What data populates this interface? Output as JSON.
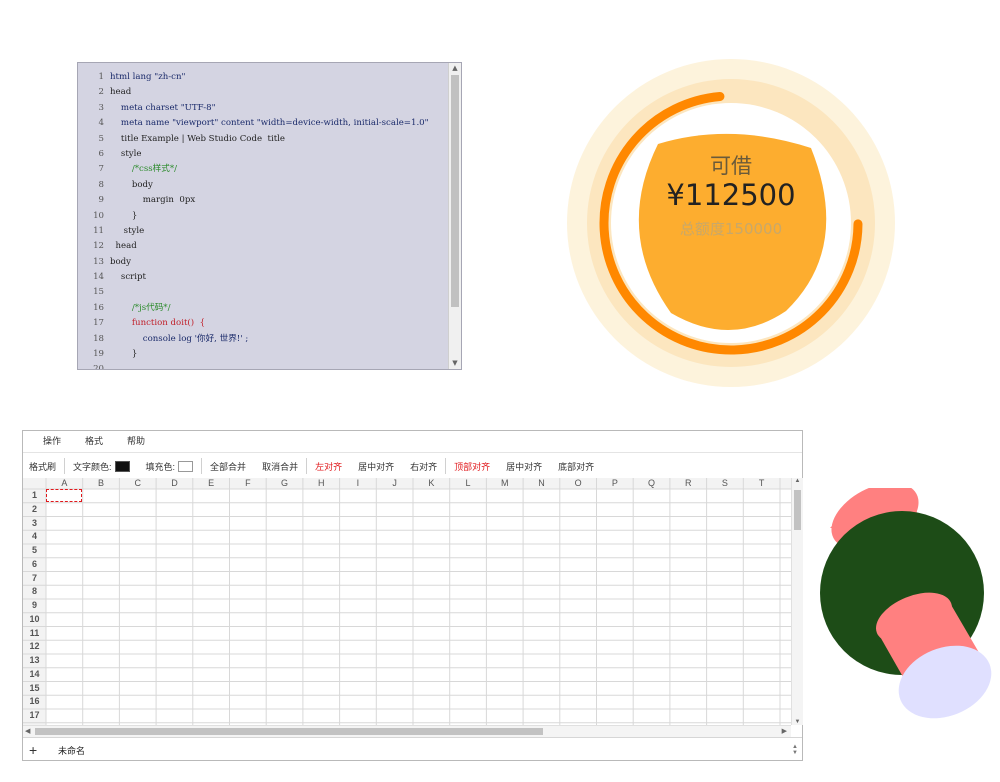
{
  "editor": {
    "lines": [
      {
        "n": "1",
        "text": "html lang \"zh-cn\""
      },
      {
        "n": "2",
        "text": "head"
      },
      {
        "n": "3",
        "text": "    meta charset \"UTF-8\""
      },
      {
        "n": "4",
        "text": "    meta name \"viewport\" content \"width=device-width, initial-scale=1.0\""
      },
      {
        "n": "5",
        "text": "    title Example | Web Studio Code  title"
      },
      {
        "n": "6",
        "text": "    style"
      },
      {
        "n": "7",
        "text": "        /*css样式*/"
      },
      {
        "n": "8",
        "text": "        body"
      },
      {
        "n": "9",
        "text": "            margin  0px"
      },
      {
        "n": "10",
        "text": "        }"
      },
      {
        "n": "11",
        "text": "     style"
      },
      {
        "n": "12",
        "text": "  head"
      },
      {
        "n": "13",
        "text": "body"
      },
      {
        "n": "14",
        "text": "    script"
      },
      {
        "n": "15",
        "text": ""
      },
      {
        "n": "16",
        "text": "        /*js代码*/"
      },
      {
        "n": "17",
        "text": "        function doit()  {"
      },
      {
        "n": "18",
        "text": "            console log '你好, 世界!' ;"
      },
      {
        "n": "19",
        "text": "        }"
      },
      {
        "n": "20",
        "text": ""
      }
    ],
    "scroll_up": "▲",
    "scroll_down": "▼"
  },
  "gauge": {
    "title": "可借",
    "amount": "¥112500",
    "total": "总额度150000",
    "available": 112500,
    "limit": 150000,
    "colors": {
      "outer": "#fdf1d8",
      "ring": "#ff8800",
      "inner": "#fdad2f"
    }
  },
  "sheet": {
    "menu": [
      "操作",
      "格式",
      "帮助"
    ],
    "toolbar": {
      "format_painter": "格式刷",
      "font_color": "文字颜色:",
      "fill_color": "填充色:",
      "merge_all": "全部合并",
      "unmerge": "取消合并",
      "align_left": "左对齐",
      "align_center": "居中对齐",
      "align_right": "右对齐",
      "align_top": "顶部对齐",
      "align_middle": "居中对齐",
      "align_bottom": "底部对齐"
    },
    "columns": [
      "A",
      "B",
      "C",
      "D",
      "E",
      "F",
      "G",
      "H",
      "I",
      "J",
      "K",
      "L",
      "M",
      "N",
      "O",
      "P",
      "Q",
      "R",
      "S",
      "T"
    ],
    "rows": [
      "1",
      "2",
      "3",
      "4",
      "5",
      "6",
      "7",
      "8",
      "9",
      "10",
      "11",
      "12",
      "13",
      "14",
      "15",
      "16",
      "17"
    ],
    "selected_cell": "A1",
    "add_sheet": "+",
    "sheet_tab": "未命名",
    "accent_color": "#e0191c"
  },
  "shape3d": {
    "colors": {
      "body": "#1d4c17",
      "cylinder_side": "#ff8080",
      "cylinder_cap": "#e0e0ff"
    }
  }
}
